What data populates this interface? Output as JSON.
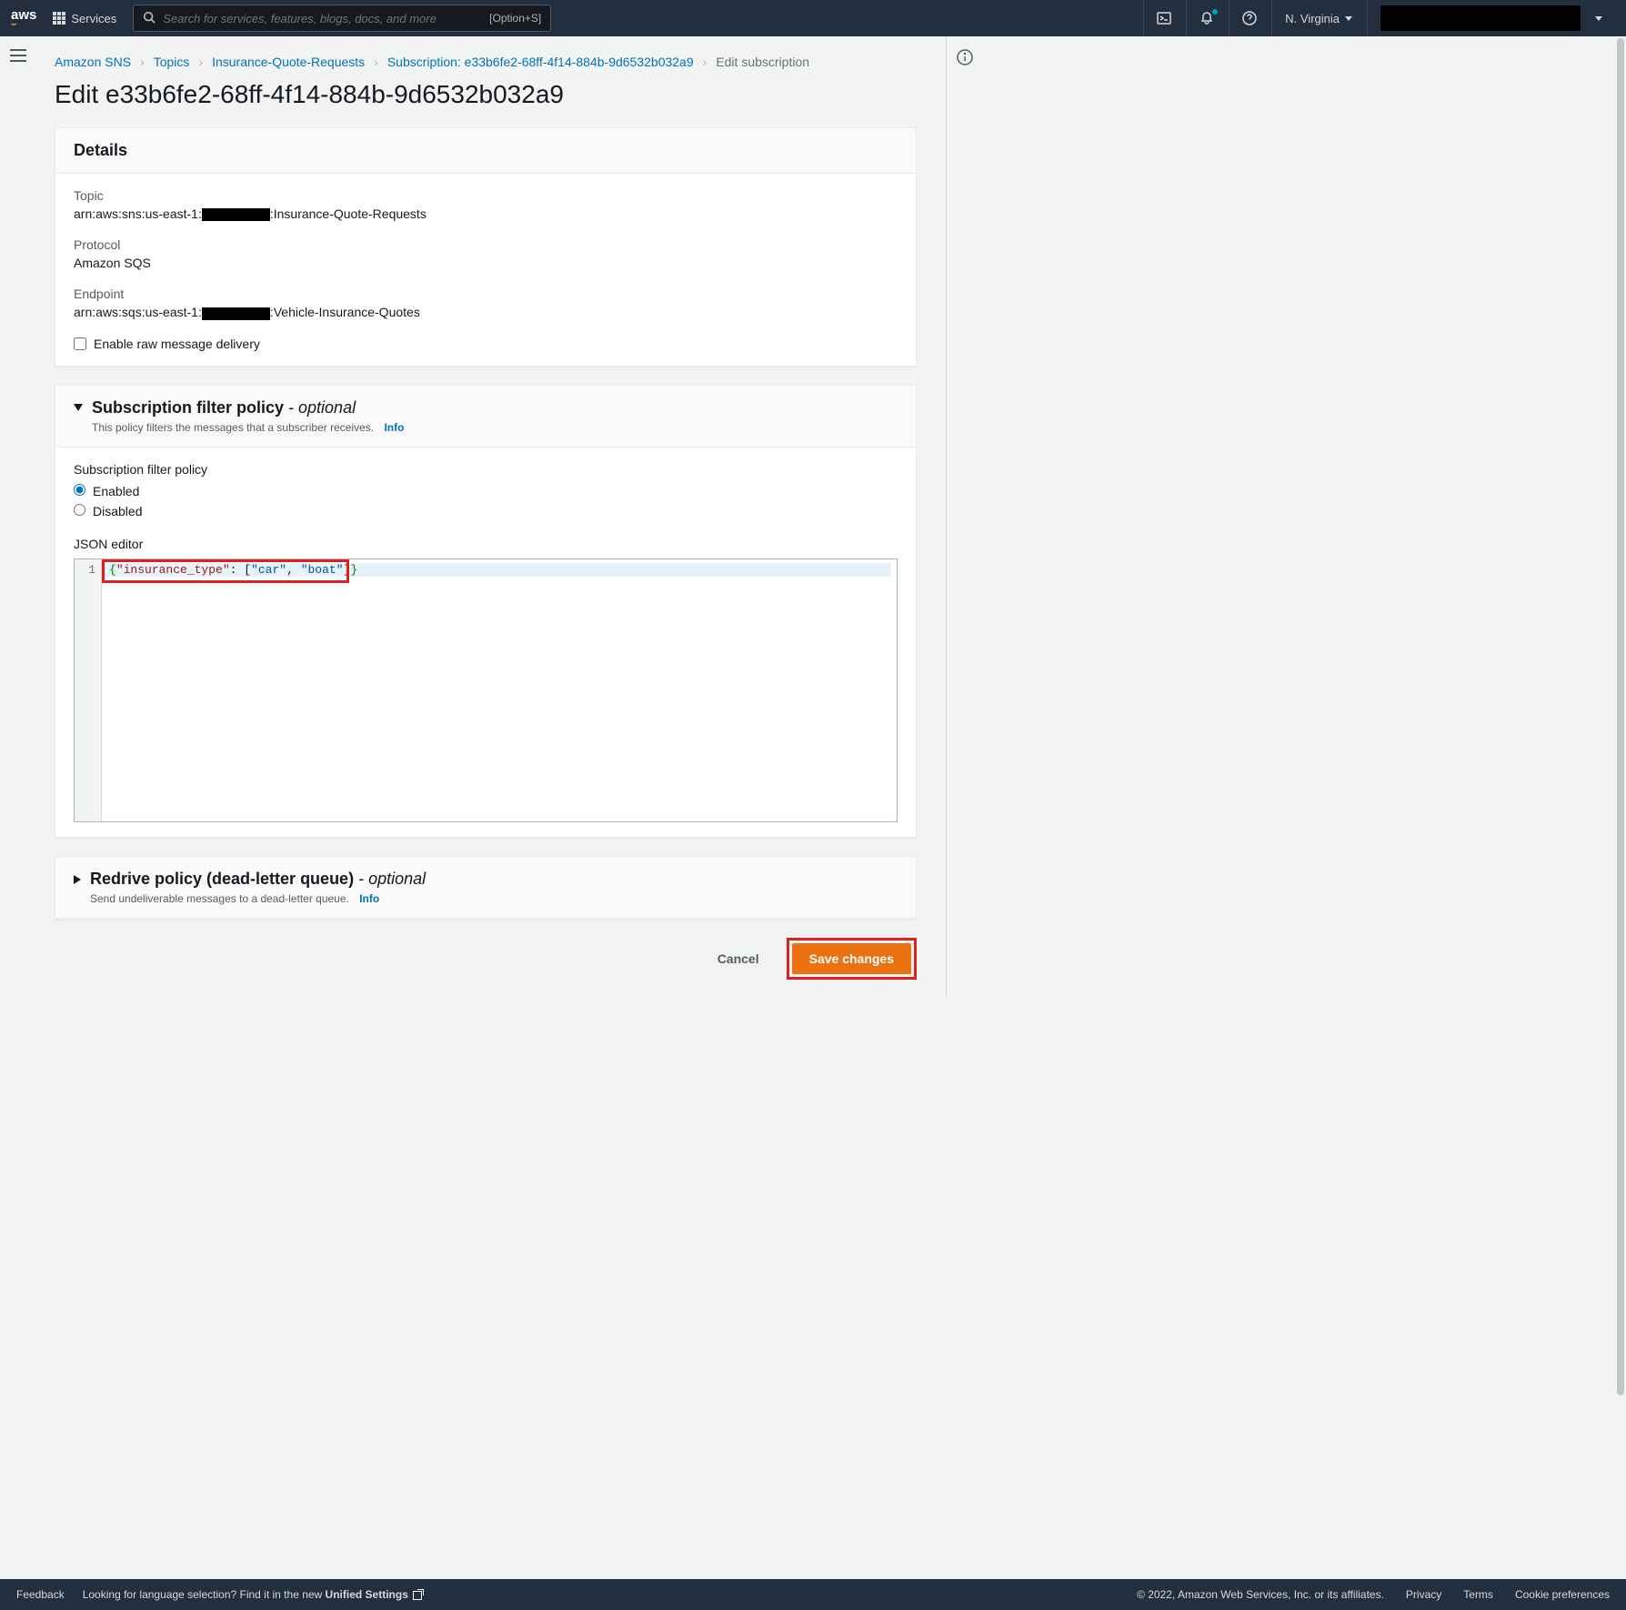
{
  "header": {
    "services_label": "Services",
    "search_placeholder": "Search for services, features, blogs, docs, and more",
    "search_shortcut": "[Option+S]",
    "region": "N. Virginia"
  },
  "breadcrumbs": {
    "items": [
      "Amazon SNS",
      "Topics",
      "Insurance-Quote-Requests",
      "Subscription: e33b6fe2-68ff-4f14-884b-9d6532b032a9"
    ],
    "current": "Edit subscription"
  },
  "page_title": "Edit e33b6fe2-68ff-4f14-884b-9d6532b032a9",
  "details": {
    "heading": "Details",
    "topic_label": "Topic",
    "topic_prefix": "arn:aws:sns:us-east-1:",
    "topic_suffix": ":Insurance-Quote-Requests",
    "protocol_label": "Protocol",
    "protocol_value": "Amazon SQS",
    "endpoint_label": "Endpoint",
    "endpoint_prefix": "arn:aws:sqs:us-east-1:",
    "endpoint_suffix": ":Vehicle-Insurance-Quotes",
    "raw_delivery_label": "Enable raw message delivery"
  },
  "filter_policy": {
    "heading": "Subscription filter policy",
    "optional": " - optional",
    "subtitle": "This policy filters the messages that a subscriber receives.",
    "info_label": "Info",
    "section_label": "Subscription filter policy",
    "enabled_label": "Enabled",
    "disabled_label": "Disabled",
    "json_label": "JSON editor",
    "json_line_number": "1",
    "json_tokens": {
      "open": "{",
      "key": "\"insurance_type\"",
      "colon": ": ",
      "bracket_open": "[",
      "val1": "\"car\"",
      "comma": ", ",
      "val2": "\"boat\"",
      "bracket_close": "]",
      "close": "}"
    }
  },
  "redrive": {
    "heading": "Redrive policy (dead-letter queue)",
    "optional": " - optional",
    "subtitle": "Send undeliverable messages to a dead-letter queue.",
    "info_label": "Info"
  },
  "actions": {
    "cancel": "Cancel",
    "save": "Save changes"
  },
  "footer": {
    "feedback": "Feedback",
    "lang_prompt": "Looking for language selection? Find it in the new ",
    "unified": "Unified Settings",
    "copyright": "© 2022, Amazon Web Services, Inc. or its affiliates.",
    "privacy": "Privacy",
    "terms": "Terms",
    "cookie": "Cookie preferences"
  }
}
